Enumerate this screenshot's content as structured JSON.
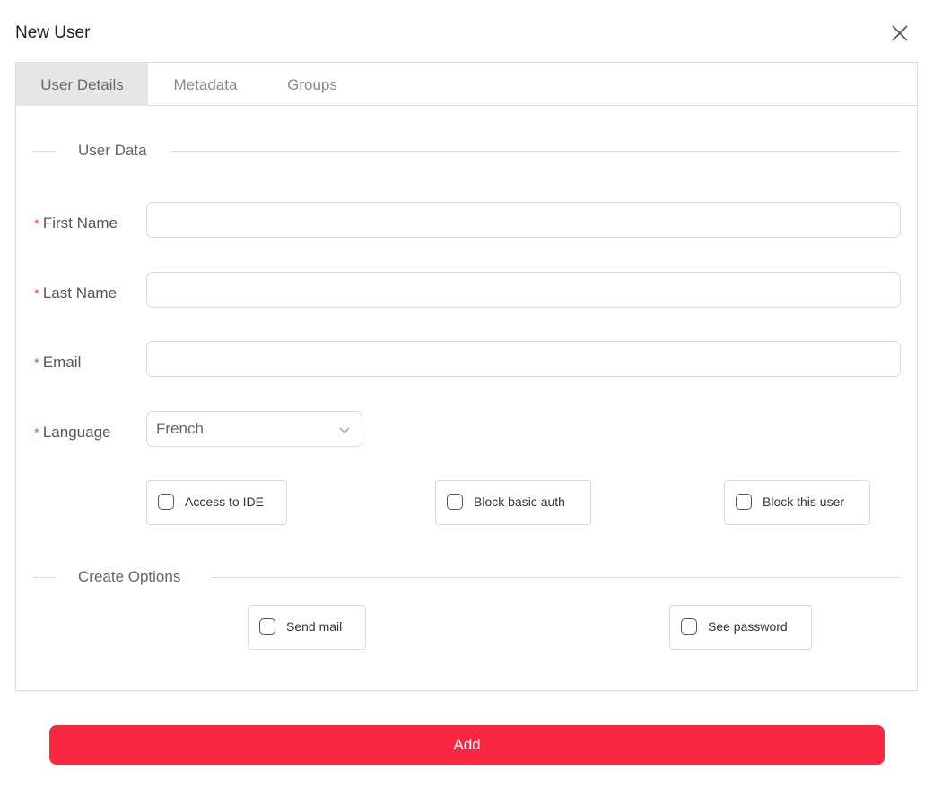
{
  "dialog": {
    "title": "New User",
    "close_icon": "close-icon"
  },
  "tabs": [
    {
      "label": "User Details",
      "active": true
    },
    {
      "label": "Metadata",
      "active": false
    },
    {
      "label": "Groups",
      "active": false
    }
  ],
  "sections": {
    "user_data": "User Data",
    "create_options": "Create Options"
  },
  "fields": {
    "first_name": {
      "label": "First Name",
      "required_mark": "*",
      "value": ""
    },
    "last_name": {
      "label": "Last Name",
      "required_mark": "*",
      "value": ""
    },
    "email": {
      "label": "Email",
      "required_mark": "*",
      "value": ""
    },
    "language": {
      "label": "Language",
      "required_mark": "*",
      "value": "French",
      "icon": "chevron-down-icon"
    }
  },
  "user_options": [
    {
      "label": "Access to IDE",
      "checked": false
    },
    {
      "label": "Block basic auth",
      "checked": false
    },
    {
      "label": "Block this user",
      "checked": false
    }
  ],
  "create_options": [
    {
      "label": "Send mail",
      "checked": false
    },
    {
      "label": "See password",
      "checked": false
    }
  ],
  "submit": {
    "label": "Add"
  },
  "colors": {
    "accent": "#fb2740",
    "required": "#e0524a",
    "active_tab_bg": "#e6e6e6",
    "border": "#d9d9d9"
  }
}
